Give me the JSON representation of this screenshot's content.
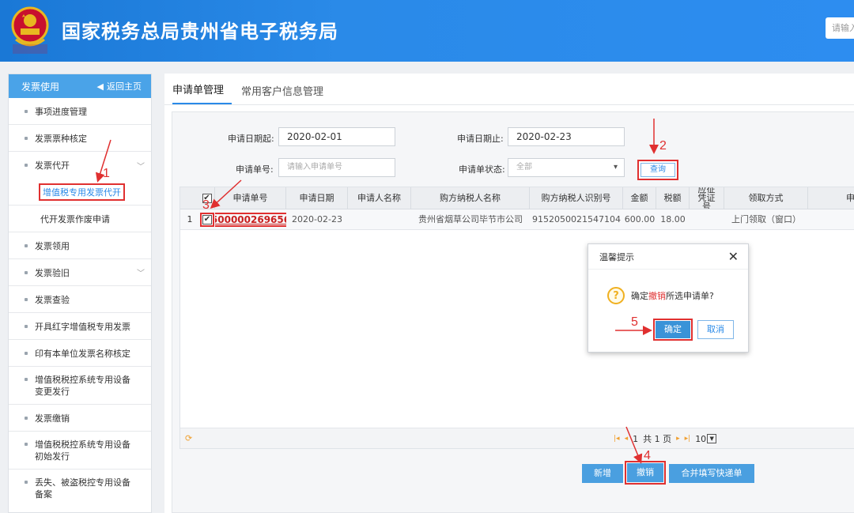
{
  "header": {
    "title": "国家税务总局贵州省电子税务局",
    "emblem_text": "税务总局",
    "search_placeholder": "请输入"
  },
  "sidebar": {
    "title": "发票使用",
    "home_label": "返回主页",
    "items": [
      {
        "label": "事项进度管理"
      },
      {
        "label": "发票票种核定"
      },
      {
        "label": "发票代开",
        "expandable": true,
        "children": [
          {
            "label": "增值税专用发票代开",
            "active": true
          },
          {
            "label": "代开发票作废申请"
          }
        ]
      },
      {
        "label": "发票领用"
      },
      {
        "label": "发票验旧",
        "expandable": true
      },
      {
        "label": "发票查验"
      },
      {
        "label": "开具红字增值税专用发票"
      },
      {
        "label": "印有本单位发票名称核定"
      },
      {
        "label": "增值税税控系统专用设备\n变更发行"
      },
      {
        "label": "发票缴销"
      },
      {
        "label": "增值税税控系统专用设备\n初始发行"
      },
      {
        "label": "丢失、被盗税控专用设备\n备案"
      }
    ]
  },
  "tabs": [
    {
      "label": "申请单管理",
      "active": true
    },
    {
      "label": "常用客户信息管理"
    }
  ],
  "form": {
    "date_from_label": "申请日期起:",
    "date_from_value": "2020-02-01",
    "date_to_label": "申请日期止:",
    "date_to_value": "2020-02-23",
    "app_no_label": "申请单号:",
    "app_no_placeholder": "请输入申请单号",
    "status_label": "申请单状态:",
    "status_value": "全部",
    "query_label": "查询"
  },
  "table": {
    "headers": [
      "申请单号",
      "申请日期",
      "申请人名称",
      "购方纳税人名称",
      "购方纳税人识别号",
      "金额",
      "税额",
      "应征凭证号",
      "领取方式",
      "申"
    ],
    "rows": [
      {
        "index": "1",
        "checked": true,
        "app_no": "500000269656",
        "date": "2020-02-23",
        "applicant": "",
        "buyer_name": "贵州省烟草公司毕节市公司",
        "buyer_tax_id": "915205002154710​4",
        "amount": "600.00",
        "tax": "18.00",
        "voucher_no": "",
        "pickup": "上门领取（窗口）"
      }
    ]
  },
  "pager": {
    "page_no": "1",
    "total_text": "共 1 页",
    "page_size": "10"
  },
  "actions": {
    "new_label": "新增",
    "revoke_label": "撤销",
    "merge_label": "合并填写快递单"
  },
  "dialog": {
    "title": "温馨提示",
    "msg_prefix": "确定",
    "msg_highlight": "撤销",
    "msg_suffix": "所选申请单?",
    "ok_label": "确定",
    "cancel_label": "取消"
  },
  "annotations": [
    "1",
    "2",
    "3",
    "4",
    "5"
  ],
  "colors": {
    "header_blue": "#2a8ae8",
    "annotation_red": "#e03030"
  }
}
